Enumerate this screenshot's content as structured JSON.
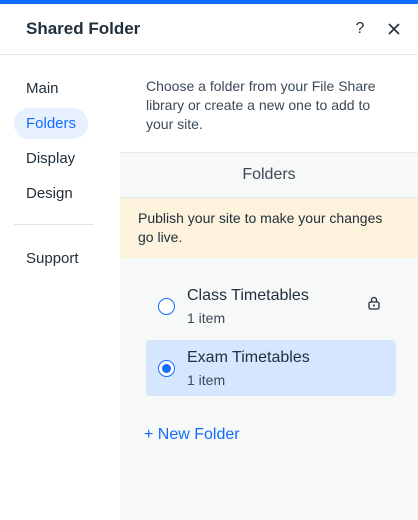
{
  "header": {
    "title": "Shared Folder",
    "help_icon": "question-mark-icon",
    "close_icon": "close-icon"
  },
  "sidebar": {
    "items": [
      {
        "label": "Main",
        "active": false
      },
      {
        "label": "Folders",
        "active": true
      },
      {
        "label": "Display",
        "active": false
      },
      {
        "label": "Design",
        "active": false
      }
    ],
    "support_label": "Support"
  },
  "main": {
    "intro": "Choose a folder from your File Share library or create a new one to add to your site.",
    "section_title": "Folders",
    "notice": "Publish your site to make your changes go live.",
    "folders": [
      {
        "name": "Class Timetables",
        "count": "1 item",
        "selected": false,
        "locked": true
      },
      {
        "name": "Exam Timetables",
        "count": "1 item",
        "selected": true,
        "locked": false
      }
    ],
    "new_folder_label": "+ New Folder"
  },
  "colors": {
    "accent": "#116dff",
    "selected_bg": "#d6e6fe",
    "notice_bg": "#fdf3dc"
  }
}
